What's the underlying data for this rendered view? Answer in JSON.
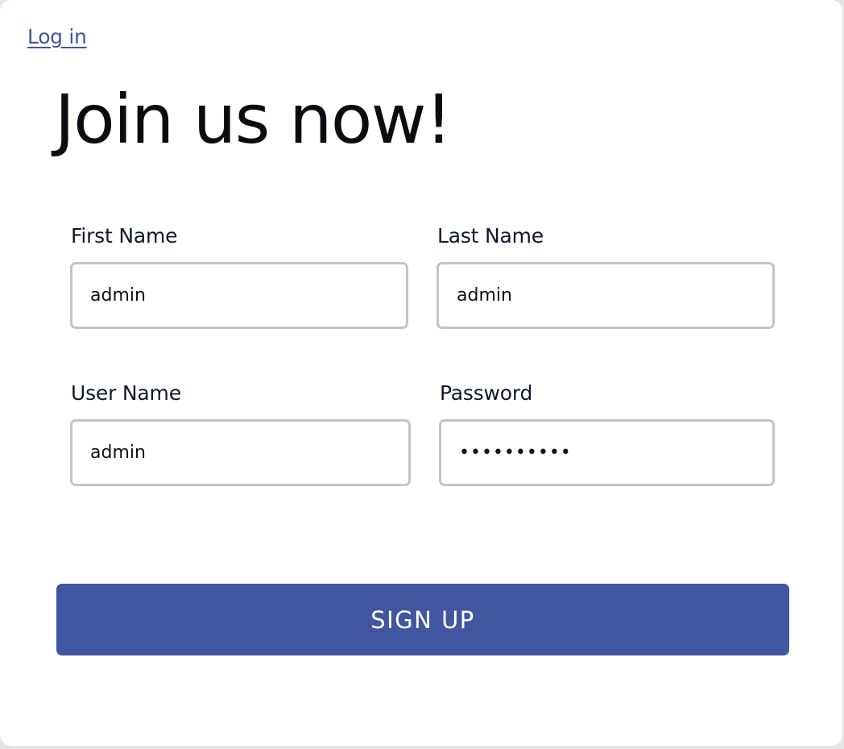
{
  "header": {
    "login_link": "Log in"
  },
  "title": "Join us now!",
  "form": {
    "first_name": {
      "label": "First Name",
      "value": "admin"
    },
    "last_name": {
      "label": "Last Name",
      "value": "admin"
    },
    "user_name": {
      "label": "User Name",
      "value": "admin"
    },
    "password": {
      "label": "Password",
      "value": "admin12345"
    }
  },
  "signup_button": "SIGN UP",
  "colors": {
    "accent": "#4056a1",
    "link": "#3f55a0",
    "input_border": "#c4c4c4"
  }
}
